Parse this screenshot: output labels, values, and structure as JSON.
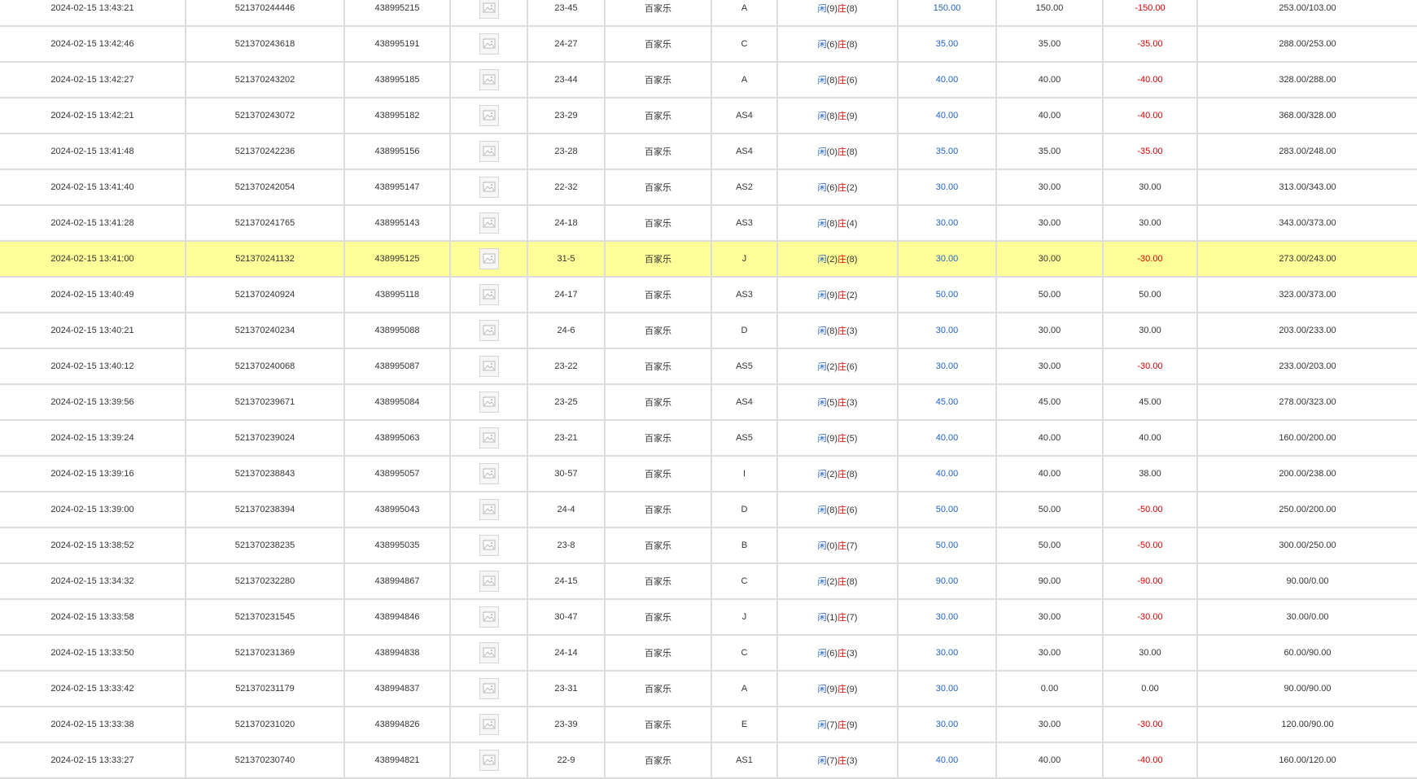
{
  "colors": {
    "positive_blue": "#1f63c6",
    "negative_red": "#e00000",
    "highlight": "#ffff99",
    "grid": "#dcdcdc"
  },
  "icon": "bet-detail-image-icon",
  "result_labels": {
    "player": "闲",
    "banker": "庄"
  },
  "rows": [
    {
      "time": "2024-02-15 13:43:21",
      "bet_id": "521370244446",
      "room_id": "438995215",
      "round": "23-45",
      "game": "百家乐",
      "table": "A",
      "player_pts": "(9)",
      "banker_pts": "(8)",
      "bet": "150.00",
      "valid": "150.00",
      "win_loss": "-150.00",
      "balance": "253.00/103.00",
      "win_neg": true,
      "highlight": false
    },
    {
      "time": "2024-02-15 13:42:46",
      "bet_id": "521370243618",
      "room_id": "438995191",
      "round": "24-27",
      "game": "百家乐",
      "table": "C",
      "player_pts": "(6)",
      "banker_pts": "(8)",
      "bet": "35.00",
      "valid": "35.00",
      "win_loss": "-35.00",
      "balance": "288.00/253.00",
      "win_neg": true,
      "highlight": false
    },
    {
      "time": "2024-02-15 13:42:27",
      "bet_id": "521370243202",
      "room_id": "438995185",
      "round": "23-44",
      "game": "百家乐",
      "table": "A",
      "player_pts": "(8)",
      "banker_pts": "(6)",
      "bet": "40.00",
      "valid": "40.00",
      "win_loss": "-40.00",
      "balance": "328.00/288.00",
      "win_neg": true,
      "highlight": false
    },
    {
      "time": "2024-02-15 13:42:21",
      "bet_id": "521370243072",
      "room_id": "438995182",
      "round": "23-29",
      "game": "百家乐",
      "table": "AS4",
      "player_pts": "(8)",
      "banker_pts": "(9)",
      "bet": "40.00",
      "valid": "40.00",
      "win_loss": "-40.00",
      "balance": "368.00/328.00",
      "win_neg": true,
      "highlight": false
    },
    {
      "time": "2024-02-15 13:41:48",
      "bet_id": "521370242236",
      "room_id": "438995156",
      "round": "23-28",
      "game": "百家乐",
      "table": "AS4",
      "player_pts": "(0)",
      "banker_pts": "(8)",
      "bet": "35.00",
      "valid": "35.00",
      "win_loss": "-35.00",
      "balance": "283.00/248.00",
      "win_neg": true,
      "highlight": false
    },
    {
      "time": "2024-02-15 13:41:40",
      "bet_id": "521370242054",
      "room_id": "438995147",
      "round": "22-32",
      "game": "百家乐",
      "table": "AS2",
      "player_pts": "(6)",
      "banker_pts": "(2)",
      "bet": "30.00",
      "valid": "30.00",
      "win_loss": "30.00",
      "balance": "313.00/343.00",
      "win_neg": false,
      "highlight": false
    },
    {
      "time": "2024-02-15 13:41:28",
      "bet_id": "521370241765",
      "room_id": "438995143",
      "round": "24-18",
      "game": "百家乐",
      "table": "AS3",
      "player_pts": "(8)",
      "banker_pts": "(4)",
      "bet": "30.00",
      "valid": "30.00",
      "win_loss": "30.00",
      "balance": "343.00/373.00",
      "win_neg": false,
      "highlight": false
    },
    {
      "time": "2024-02-15 13:41:00",
      "bet_id": "521370241132",
      "room_id": "438995125",
      "round": "31-5",
      "game": "百家乐",
      "table": "J",
      "player_pts": "(2)",
      "banker_pts": "(8)",
      "bet": "30.00",
      "valid": "30.00",
      "win_loss": "-30.00",
      "balance": "273.00/243.00",
      "win_neg": true,
      "highlight": true
    },
    {
      "time": "2024-02-15 13:40:49",
      "bet_id": "521370240924",
      "room_id": "438995118",
      "round": "24-17",
      "game": "百家乐",
      "table": "AS3",
      "player_pts": "(9)",
      "banker_pts": "(2)",
      "bet": "50.00",
      "valid": "50.00",
      "win_loss": "50.00",
      "balance": "323.00/373.00",
      "win_neg": false,
      "highlight": false
    },
    {
      "time": "2024-02-15 13:40:21",
      "bet_id": "521370240234",
      "room_id": "438995088",
      "round": "24-6",
      "game": "百家乐",
      "table": "D",
      "player_pts": "(8)",
      "banker_pts": "(3)",
      "bet": "30.00",
      "valid": "30.00",
      "win_loss": "30.00",
      "balance": "203.00/233.00",
      "win_neg": false,
      "highlight": false
    },
    {
      "time": "2024-02-15 13:40:12",
      "bet_id": "521370240068",
      "room_id": "438995087",
      "round": "23-22",
      "game": "百家乐",
      "table": "AS5",
      "player_pts": "(2)",
      "banker_pts": "(6)",
      "bet": "30.00",
      "valid": "30.00",
      "win_loss": "-30.00",
      "balance": "233.00/203.00",
      "win_neg": true,
      "highlight": false
    },
    {
      "time": "2024-02-15 13:39:56",
      "bet_id": "521370239671",
      "room_id": "438995084",
      "round": "23-25",
      "game": "百家乐",
      "table": "AS4",
      "player_pts": "(5)",
      "banker_pts": "(3)",
      "bet": "45.00",
      "valid": "45.00",
      "win_loss": "45.00",
      "balance": "278.00/323.00",
      "win_neg": false,
      "highlight": false
    },
    {
      "time": "2024-02-15 13:39:24",
      "bet_id": "521370239024",
      "room_id": "438995063",
      "round": "23-21",
      "game": "百家乐",
      "table": "AS5",
      "player_pts": "(9)",
      "banker_pts": "(5)",
      "bet": "40.00",
      "valid": "40.00",
      "win_loss": "40.00",
      "balance": "160.00/200.00",
      "win_neg": false,
      "highlight": false
    },
    {
      "time": "2024-02-15 13:39:16",
      "bet_id": "521370238843",
      "room_id": "438995057",
      "round": "30-57",
      "game": "百家乐",
      "table": "I",
      "player_pts": "(2)",
      "banker_pts": "(8)",
      "bet": "40.00",
      "valid": "40.00",
      "win_loss": "38.00",
      "balance": "200.00/238.00",
      "win_neg": false,
      "highlight": false
    },
    {
      "time": "2024-02-15 13:39:00",
      "bet_id": "521370238394",
      "room_id": "438995043",
      "round": "24-4",
      "game": "百家乐",
      "table": "D",
      "player_pts": "(8)",
      "banker_pts": "(6)",
      "bet": "50.00",
      "valid": "50.00",
      "win_loss": "-50.00",
      "balance": "250.00/200.00",
      "win_neg": true,
      "highlight": false
    },
    {
      "time": "2024-02-15 13:38:52",
      "bet_id": "521370238235",
      "room_id": "438995035",
      "round": "23-8",
      "game": "百家乐",
      "table": "B",
      "player_pts": "(0)",
      "banker_pts": "(7)",
      "bet": "50.00",
      "valid": "50.00",
      "win_loss": "-50.00",
      "balance": "300.00/250.00",
      "win_neg": true,
      "highlight": false
    },
    {
      "time": "2024-02-15 13:34:32",
      "bet_id": "521370232280",
      "room_id": "438994867",
      "round": "24-15",
      "game": "百家乐",
      "table": "C",
      "player_pts": "(2)",
      "banker_pts": "(8)",
      "bet": "90.00",
      "valid": "90.00",
      "win_loss": "-90.00",
      "balance": "90.00/0.00",
      "win_neg": true,
      "highlight": false
    },
    {
      "time": "2024-02-15 13:33:58",
      "bet_id": "521370231545",
      "room_id": "438994846",
      "round": "30-47",
      "game": "百家乐",
      "table": "J",
      "player_pts": "(1)",
      "banker_pts": "(7)",
      "bet": "30.00",
      "valid": "30.00",
      "win_loss": "-30.00",
      "balance": "30.00/0.00",
      "win_neg": true,
      "highlight": false
    },
    {
      "time": "2024-02-15 13:33:50",
      "bet_id": "521370231369",
      "room_id": "438994838",
      "round": "24-14",
      "game": "百家乐",
      "table": "C",
      "player_pts": "(6)",
      "banker_pts": "(3)",
      "bet": "30.00",
      "valid": "30.00",
      "win_loss": "30.00",
      "balance": "60.00/90.00",
      "win_neg": false,
      "highlight": false
    },
    {
      "time": "2024-02-15 13:33:42",
      "bet_id": "521370231179",
      "room_id": "438994837",
      "round": "23-31",
      "game": "百家乐",
      "table": "A",
      "player_pts": "(9)",
      "banker_pts": "(9)",
      "bet": "30.00",
      "valid": "0.00",
      "win_loss": "0.00",
      "balance": "90.00/90.00",
      "win_neg": false,
      "highlight": false
    },
    {
      "time": "2024-02-15 13:33:38",
      "bet_id": "521370231020",
      "room_id": "438994826",
      "round": "23-39",
      "game": "百家乐",
      "table": "E",
      "player_pts": "(7)",
      "banker_pts": "(9)",
      "bet": "30.00",
      "valid": "30.00",
      "win_loss": "-30.00",
      "balance": "120.00/90.00",
      "win_neg": true,
      "highlight": false
    },
    {
      "time": "2024-02-15 13:33:27",
      "bet_id": "521370230740",
      "room_id": "438994821",
      "round": "22-9",
      "game": "百家乐",
      "table": "AS1",
      "player_pts": "(7)",
      "banker_pts": "(3)",
      "bet": "40.00",
      "valid": "40.00",
      "win_loss": "-40.00",
      "balance": "160.00/120.00",
      "win_neg": true,
      "highlight": false
    }
  ]
}
